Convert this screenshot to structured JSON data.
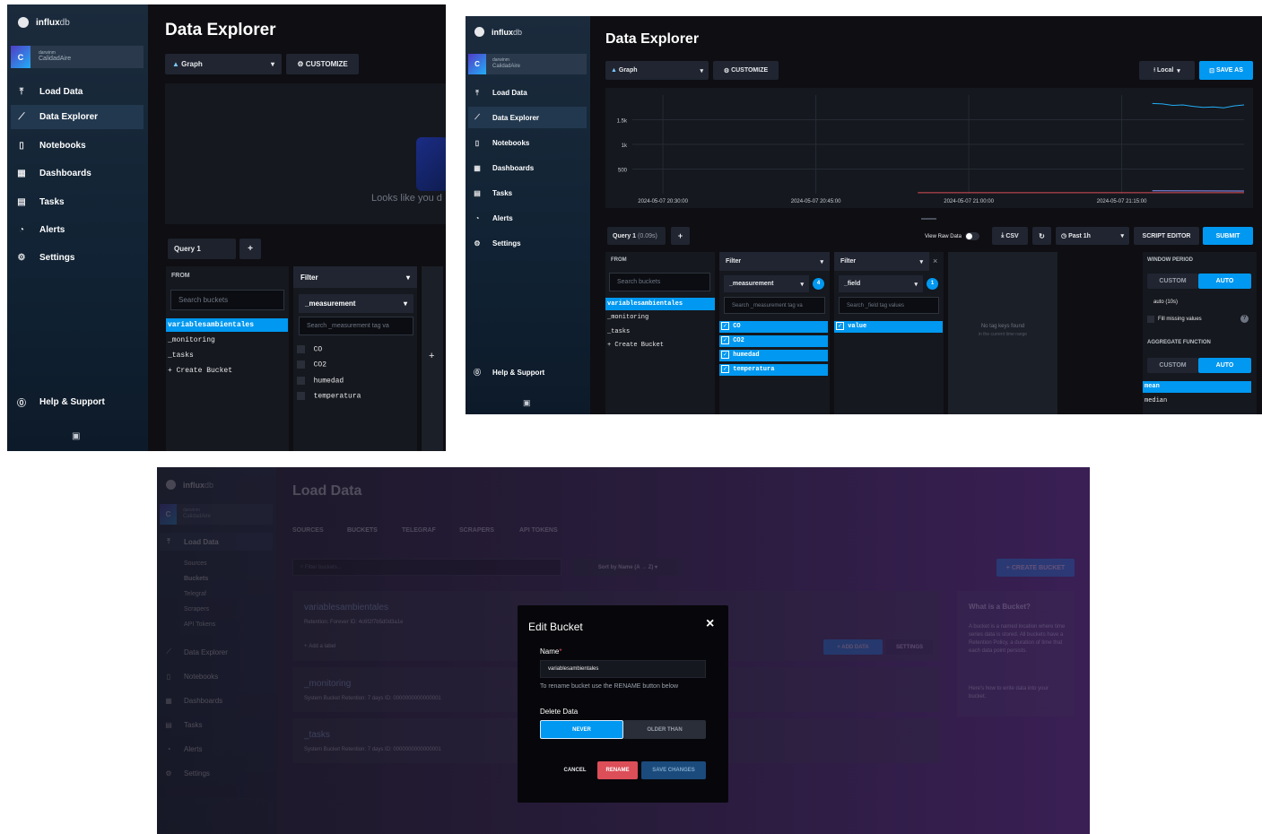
{
  "brand": {
    "name_bold": "influx",
    "name_light": "db"
  },
  "org": {
    "avatar": "C",
    "user": "darwinm",
    "name": "CalidadAire"
  },
  "nav": {
    "load_data": "Load Data",
    "data_explorer": "Data Explorer",
    "notebooks": "Notebooks",
    "dashboards": "Dashboards",
    "tasks": "Tasks",
    "alerts": "Alerts",
    "settings": "Settings",
    "help": "Help & Support"
  },
  "explorer": {
    "title": "Data Explorer",
    "graph_type": "Graph",
    "customize": "CUSTOMIZE",
    "empty_msg": "Looks like you d",
    "query_tab": "Query 1",
    "query_time": "(0.09s)",
    "add": "+",
    "from_label": "FROM",
    "search_buckets": "Search buckets",
    "buckets": [
      "variablesambientales",
      "_monitoring",
      "_tasks",
      "+ Create Bucket"
    ],
    "filter_label": "Filter",
    "measurement_key": "_measurement",
    "measurement_search": "Search _measurement tag va",
    "measurements": [
      "CO",
      "CO2",
      "humedad",
      "temperatura"
    ],
    "field_key": "_field",
    "field_search": "Search _field tag values",
    "fields": [
      "value"
    ],
    "measurement_count": "4",
    "field_count": "1",
    "no_tag_keys": "No tag keys found",
    "no_tag_sub": "in the current time range",
    "local": "Local",
    "save_as": "SAVE AS",
    "view_raw": "View Raw Data",
    "csv": "CSV",
    "past": "Past 1h",
    "script_editor": "SCRIPT EDITOR",
    "submit": "SUBMIT",
    "window_period": "WINDOW PERIOD",
    "custom": "CUSTOM",
    "auto": "AUTO",
    "auto_value": "auto (10s)",
    "fill_missing": "Fill missing values",
    "aggregate": "AGGREGATE FUNCTION",
    "agg_functions": [
      "mean",
      "median"
    ]
  },
  "chart_data": {
    "type": "line",
    "y_ticks": [
      "1.5k",
      "1k",
      "500"
    ],
    "x_ticks": [
      "2024-05-07 20:30:00",
      "2024-05-07 20:45:00",
      "2024-05-07 21:00:00",
      "2024-05-07 21:15:00"
    ],
    "ylim": [
      0,
      2000
    ],
    "series": [
      {
        "color": "#22adf6",
        "x": [
          "21:18",
          "21:19",
          "21:20",
          "21:21",
          "21:22",
          "21:23",
          "21:24",
          "21:25",
          "21:26",
          "21:27"
        ],
        "values": [
          1830,
          1820,
          1790,
          1800,
          1770,
          1750,
          1760,
          1740,
          1780,
          1800
        ]
      },
      {
        "color": "#9394ff",
        "x": [
          "21:18",
          "21:27"
        ],
        "values": [
          60,
          55
        ]
      },
      {
        "color": "#dc4e58",
        "x": [
          "20:55",
          "21:27"
        ],
        "values": [
          20,
          20
        ]
      }
    ],
    "grid": true
  },
  "loaddata": {
    "title": "Load Data",
    "tabs": [
      "SOURCES",
      "BUCKETS",
      "TELEGRAF",
      "SCRAPERS",
      "API TOKENS"
    ],
    "sub_nav": [
      "Sources",
      "Buckets",
      "Telegraf",
      "Scrapers",
      "API Tokens"
    ],
    "filter_placeholder": "Filter buckets...",
    "sort": "Sort by Name (A → Z)",
    "create_bucket": "+ CREATE BUCKET",
    "bucket1": "variablesambientales",
    "bucket1_meta": "Retention: Forever    ID: 4c6f2f7b5d0d3a1e",
    "add_label": "Add a label",
    "add_data": "+ ADD DATA",
    "settings_btn": "SETTINGS",
    "bucket2": "_monitoring",
    "bucket3": "_tasks",
    "system_meta": "System Bucket    Retention: 7 days    ID: 0000000000000001",
    "info_title": "What is a Bucket?",
    "info_text": "A bucket is a named location where time series data is stored. All buckets have a Retention Policy, a duration of time that each data point persists.",
    "info_text2": "Here's how to write data into your bucket."
  },
  "modal": {
    "title": "Edit Bucket",
    "name_label": "Name",
    "name_value": "variablesambientales",
    "rename_help": "To rename bucket use the RENAME button below",
    "delete_label": "Delete Data",
    "never": "NEVER",
    "older_than": "OLDER THAN",
    "cancel": "CANCEL",
    "rename": "RENAME",
    "save": "SAVE CHANGES"
  }
}
